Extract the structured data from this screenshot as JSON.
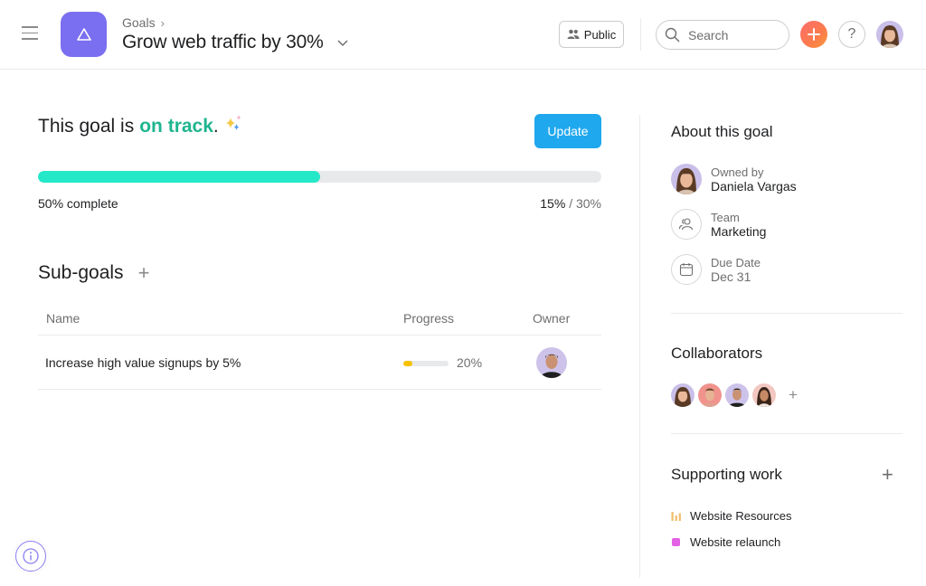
{
  "header": {
    "breadcrumb": "Goals",
    "title": "Grow web traffic by 30%",
    "public_label": "Public",
    "search_placeholder": "Search",
    "help_label": "?"
  },
  "status": {
    "prefix": "This goal is",
    "state": "on track",
    "suffix": ".",
    "update_label": "Update",
    "progress_percent": 50,
    "progress_label": "50% complete",
    "current_value": "15%",
    "target_value": "/ 30%",
    "colors": {
      "on_track": "#1fb58f",
      "progress_fill": "#25e8c8",
      "update_button": "#20a8ee"
    }
  },
  "subgoals": {
    "title": "Sub-goals",
    "add_label": "+",
    "columns": [
      "Name",
      "Progress",
      "Owner"
    ],
    "rows": [
      {
        "name": "Increase high value signups by 5%",
        "progress_percent": 20,
        "progress_label": "20%",
        "owner": "sub-goal owner"
      }
    ]
  },
  "about": {
    "title": "About this goal",
    "owner_label": "Owned by",
    "owner_name": "Daniela Vargas",
    "team_label": "Team",
    "team_name": "Marketing",
    "due_label": "Due Date",
    "due_value": "Dec 31"
  },
  "collaborators": {
    "title": "Collaborators",
    "count": 4,
    "add_label": "+"
  },
  "supporting_work": {
    "title": "Supporting work",
    "add_label": "+",
    "items": [
      {
        "label": "Website Resources",
        "icon": "bar-chart-icon",
        "color": "#f1bd6c"
      },
      {
        "label": "Website relaunch",
        "icon": "project-dot-icon",
        "color": "#e362e3"
      }
    ]
  }
}
